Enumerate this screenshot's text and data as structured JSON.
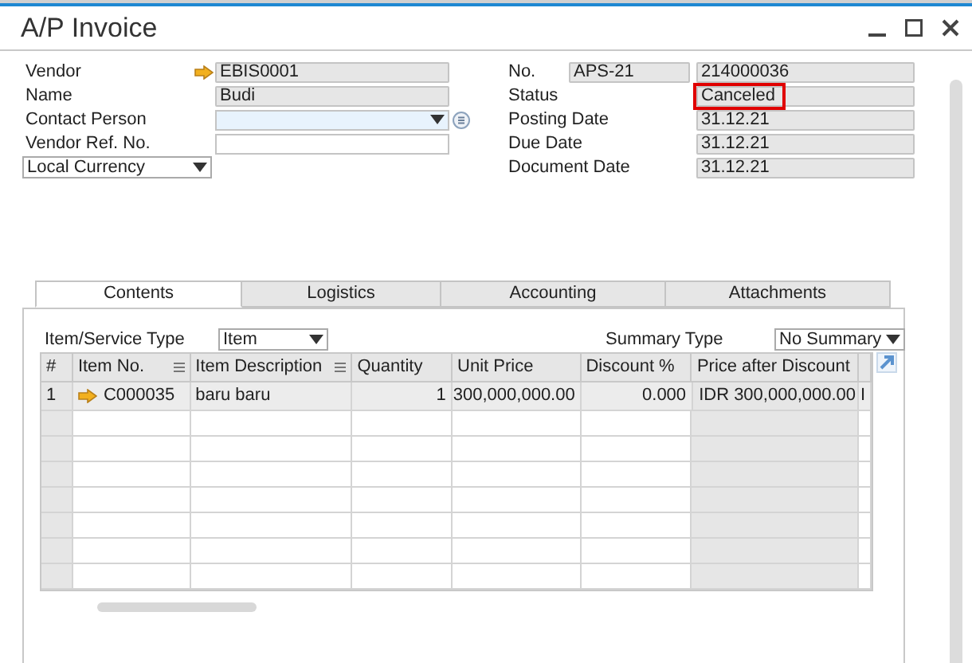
{
  "window": {
    "title": "A/P Invoice"
  },
  "header_left": [
    {
      "kind": "link_field",
      "label": "Vendor",
      "value": "EBIS0001"
    },
    {
      "kind": "field",
      "label": "Name",
      "value": "Budi"
    },
    {
      "kind": "dropdown_field",
      "label": "Contact Person"
    },
    {
      "kind": "input",
      "label": "Vendor Ref. No."
    }
  ],
  "currency_dropdown": {
    "value": "Local Currency"
  },
  "header_right": [
    {
      "kind": "series_field",
      "label": "No.",
      "series": "APS-21",
      "value": "214000036"
    },
    {
      "kind": "field",
      "label": "Status",
      "value": "Canceled",
      "highlighted": true
    },
    {
      "kind": "field",
      "label": "Posting Date",
      "value": "31.12.21",
      "highlighted": false
    },
    {
      "kind": "field",
      "label": "Due Date",
      "value": "31.12.21",
      "highlighted": false
    },
    {
      "kind": "field",
      "label": "Document Date",
      "value": "31.12.21",
      "highlighted": false
    }
  ],
  "tabs": [
    {
      "label": "Contents",
      "selected": true
    },
    {
      "label": "Logistics",
      "selected": false
    },
    {
      "label": "Accounting",
      "selected": false
    },
    {
      "label": "Attachments",
      "selected": false
    }
  ],
  "item_service_type": {
    "label": "Item/Service Type",
    "value": "Item"
  },
  "summary_type": {
    "label": "Summary Type",
    "value": "No Summary"
  },
  "table": {
    "columns": [
      {
        "label": "#",
        "menu": false,
        "shaded": true
      },
      {
        "label": "Item No.",
        "menu": true,
        "shaded": false
      },
      {
        "label": "Item Description",
        "menu": true,
        "shaded": false
      },
      {
        "label": "Quantity",
        "menu": false,
        "shaded": false
      },
      {
        "label": "Unit Price",
        "menu": false,
        "shaded": false
      },
      {
        "label": "Discount %",
        "menu": false,
        "shaded": false
      },
      {
        "label": "Price after Discount",
        "menu": false,
        "shaded": true
      },
      {
        "menu": false,
        "shaded": false
      }
    ],
    "rows": [
      {
        "cells": [
          "1",
          "C000035",
          "baru baru",
          "1",
          "300,000,000.00",
          "0.000",
          "IDR 300,000,000.00",
          "I"
        ],
        "link_arrow": true
      }
    ]
  }
}
